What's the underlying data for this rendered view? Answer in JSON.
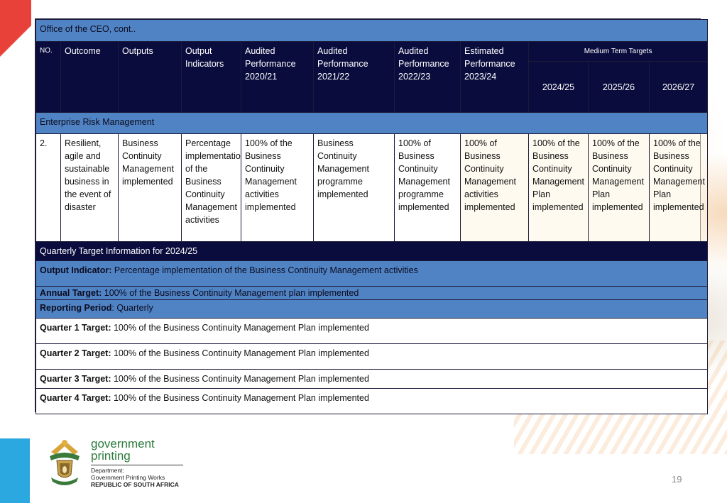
{
  "header": {
    "title": "Office of the CEO, cont.."
  },
  "columns": {
    "no": "NO.",
    "outcome": "Outcome",
    "outputs": "Outputs",
    "output_indicators": "Output Indicators",
    "audited_2020": "Audited Performance 2020/21",
    "audited_2021": "Audited Performance 2021/22",
    "audited_2022": "Audited Performance 2022/23",
    "estimated_2023": "Estimated Performance 2023/24",
    "medium_term": "Medium Term Targets",
    "y2024": "2024/25",
    "y2025": "2025/26",
    "y2026": "2026/27"
  },
  "section": {
    "title": "Enterprise Risk Management"
  },
  "row": {
    "no": "2.",
    "outcome": "Resilient, agile and sustainable business in the event of disaster",
    "outputs": "Business Continuity Management implemented",
    "indicator": "Percentage implementation of the Business Continuity Management activities",
    "audited_2020": "100% of the Business Continuity Management activities implemented",
    "audited_2021": "Business Continuity Management programme implemented",
    "audited_2022": "100% of Business Continuity Management programme implemented",
    "estimated_2023": "100% of Business Continuity Management activities implemented",
    "target_2024": "100% of the Business Continuity Management Plan implemented",
    "target_2025": "100% of the Business Continuity Management Plan implemented",
    "target_2026": "100% of the Business Continuity Management Plan implemented"
  },
  "quarterly": {
    "title": "Quarterly Target Information for 2024/25",
    "indicator_label": "Output Indicator:",
    "indicator_value": " Percentage implementation of the Business Continuity Management  activities",
    "annual_label": "Annual Target:",
    "annual_value": " 100% of the Business Continuity Management plan implemented",
    "reporting_label": "Reporting Period",
    "reporting_value": ": Quarterly",
    "q1_label": "Quarter 1 Target:",
    "q1_value": " 100% of the Business Continuity Management Plan implemented",
    "q2_label": "Quarter 2 Target:",
    "q2_value": " 100% of the Business Continuity Management Plan implemented",
    "q3_label": "Quarter 3 Target:",
    "q3_value": " 100% of the Business Continuity Management Plan implemented",
    "q4_label": "Quarter 4 Target:",
    "q4_value": " 100% of the Business Continuity Management Plan implemented"
  },
  "footer": {
    "logo_word1": "government",
    "logo_word2": "printing",
    "dept_line1": "Department:",
    "dept_line2": "Government Printing Works",
    "dept_line3": "REPUBLIC OF SOUTH AFRICA",
    "page_number": "19"
  },
  "colors": {
    "header_blue": "#5083c4",
    "navy": "#0a0c3d",
    "logo_green": "#2a7a3a"
  }
}
